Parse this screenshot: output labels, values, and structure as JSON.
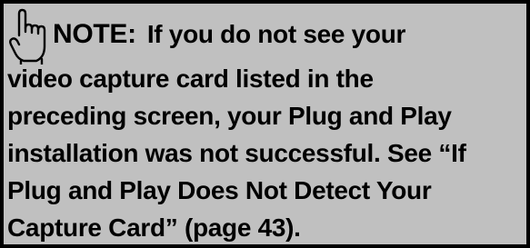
{
  "note": {
    "icon": "pointing-hand-icon",
    "label": "NOTE:",
    "lines": [
      "If you do not see your",
      "video capture card listed in the",
      "preceding screen, your Plug and Play",
      "installation was not successful. See “If",
      "Plug and Play Does Not Detect Your",
      "Capture Card” (page 43)."
    ]
  },
  "colors": {
    "background": "#c0c0c0",
    "border": "#000000",
    "text": "#000000"
  }
}
